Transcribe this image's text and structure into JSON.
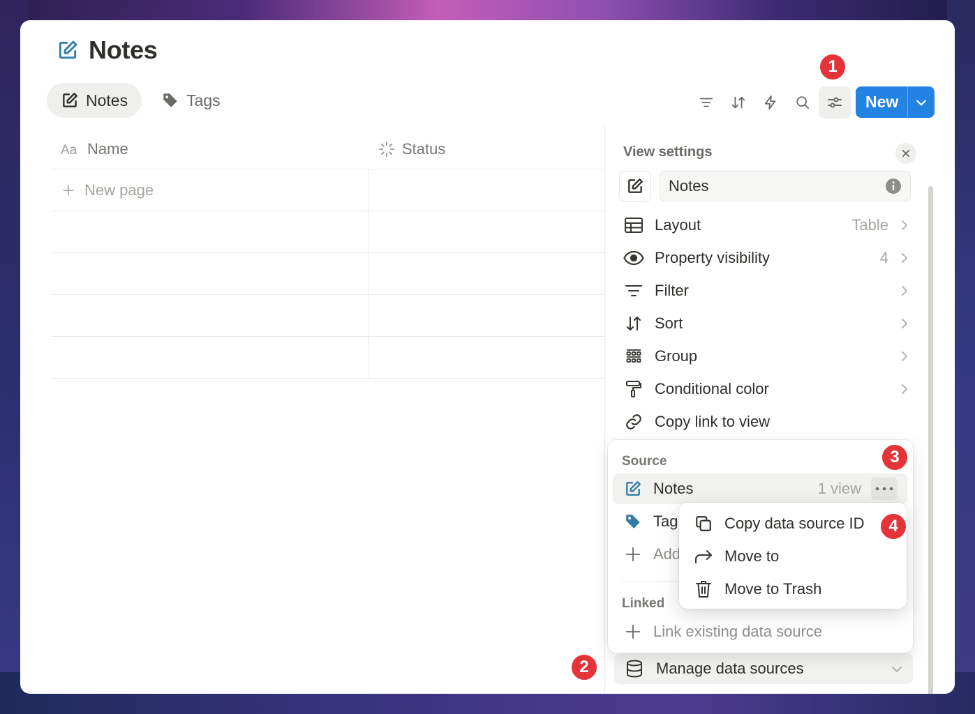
{
  "page": {
    "title": "Notes"
  },
  "tabs": [
    {
      "label": "Notes",
      "active": true,
      "icon": "note-edit-icon"
    },
    {
      "label": "Tags",
      "active": false,
      "icon": "tag-icon"
    }
  ],
  "toolbar": {
    "icons": [
      "filter-icon",
      "sort-icon",
      "automation-bolt-icon",
      "search-icon",
      "view-settings-icon"
    ],
    "new_label": "New"
  },
  "badges": [
    "1",
    "2",
    "3",
    "4"
  ],
  "table": {
    "columns": [
      {
        "label": "Name",
        "icon": "text-aa-icon"
      },
      {
        "label": "Status",
        "icon": "status-spinner-icon"
      }
    ],
    "new_page_label": "New page"
  },
  "view_settings": {
    "title": "View settings",
    "view_name": "Notes",
    "items": [
      {
        "label": "Layout",
        "value": "Table",
        "icon": "table-icon"
      },
      {
        "label": "Property visibility",
        "value": "4",
        "icon": "eye-icon"
      },
      {
        "label": "Filter",
        "value": "",
        "icon": "filter-icon"
      },
      {
        "label": "Sort",
        "value": "",
        "icon": "sort-icon"
      },
      {
        "label": "Group",
        "value": "",
        "icon": "group-icon"
      },
      {
        "label": "Conditional color",
        "value": "",
        "icon": "paint-roller-icon"
      },
      {
        "label": "Copy link to view",
        "value": "",
        "icon": "link-icon"
      }
    ],
    "manage_label": "Manage data sources"
  },
  "source_popover": {
    "source_header": "Source",
    "notes_label": "Notes",
    "notes_meta": "1 view",
    "tags_label": "Tag",
    "add_label": "Add",
    "linked_header": "Linked",
    "link_existing_label": "Link existing data source"
  },
  "context_menu": {
    "items": [
      {
        "label": "Copy data source ID",
        "icon": "copy-icon"
      },
      {
        "label": "Move to",
        "icon": "arrow-forward-icon"
      },
      {
        "label": "Move to Trash",
        "icon": "trash-icon"
      }
    ]
  },
  "colors": {
    "accent": "#2383e2",
    "badge": "#e5333a",
    "note_icon": "#337ea9"
  }
}
